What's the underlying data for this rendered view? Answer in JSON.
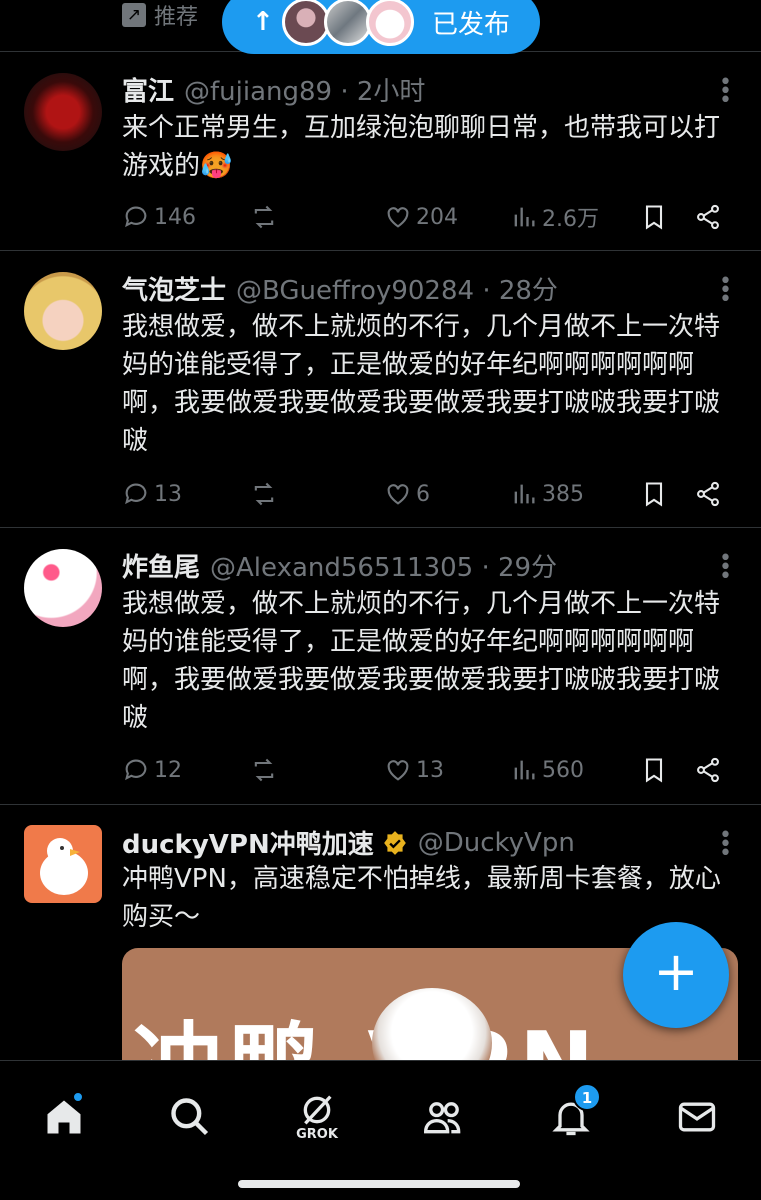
{
  "top": {
    "promo_label": "推荐",
    "posted_label": "已发布"
  },
  "tweets": [
    {
      "name": "富江",
      "handle": "@fujiang89 · 2小时",
      "text": "来个正常男生，互加绿泡泡聊聊日常，也带我可以打游戏的🥵",
      "replies": "146",
      "likes": "204",
      "views": "2.6万"
    },
    {
      "name": "气泡芝士",
      "handle": "@BGueffroy90284 · 28分",
      "text": "我想做爱，做不上就烦的不行，几个月做不上一次特妈的谁能受得了，正是做爱的好年纪啊啊啊啊啊啊啊，我要做爱我要做爱我要做爱我要打啵啵我要打啵啵",
      "replies": "13",
      "likes": "6",
      "views": "385"
    },
    {
      "name": "炸鱼尾",
      "handle": "@Alexand56511305 · 29分",
      "text": "我想做爱，做不上就烦的不行，几个月做不上一次特妈的谁能受得了，正是做爱的好年纪啊啊啊啊啊啊啊，我要做爱我要做爱我要做爱我要打啵啵我要打啵啵",
      "replies": "12",
      "likes": "13",
      "views": "560"
    },
    {
      "name": "duckyVPN冲鸭加速",
      "handle": "@DuckyVpn",
      "text": "冲鸭VPN，高速稳定不怕掉线，最新周卡套餐，放心购买～",
      "ad_image_text": "冲鸭 VPN"
    }
  ],
  "nav": {
    "grok_label": "GROK",
    "notif_count": "1"
  },
  "colors": {
    "accent": "#1d9bf0",
    "muted": "#71767b",
    "background": "#000000",
    "text": "#e7e9ea"
  }
}
